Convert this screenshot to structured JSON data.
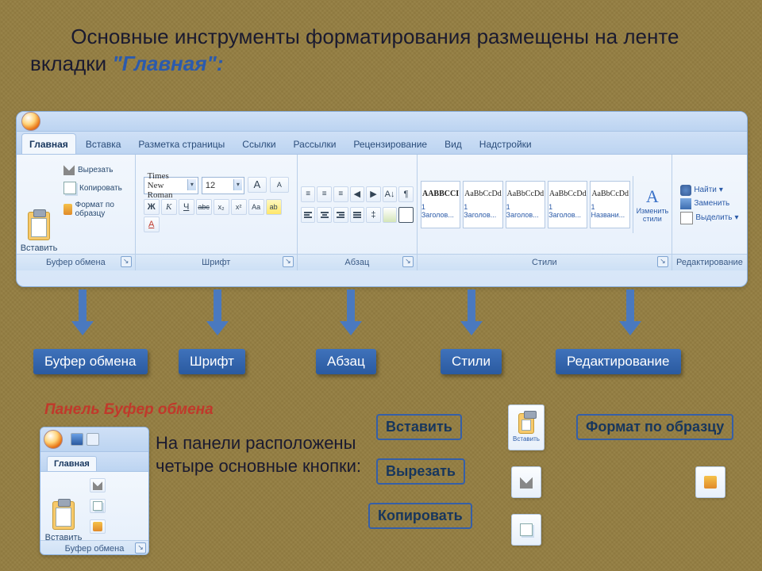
{
  "intro": {
    "text_part1": "Основные инструменты форматирования размещены на ленте вкладки ",
    "quoted": "\"Главная\"",
    "colon": ":"
  },
  "ribbon": {
    "tabs": [
      "Главная",
      "Вставка",
      "Разметка страницы",
      "Ссылки",
      "Рассылки",
      "Рецензирование",
      "Вид",
      "Надстройки"
    ],
    "active_tab_index": 0,
    "clipboard": {
      "label": "Буфер обмена",
      "paste": "Вставить",
      "cut": "Вырезать",
      "copy": "Копировать",
      "format_painter": "Формат по образцу"
    },
    "font": {
      "label": "Шрифт",
      "name": "Times New Roman",
      "size": "12",
      "grow": "A",
      "shrink": "A",
      "bold": "Ж",
      "italic": "К",
      "underline": "Ч",
      "strike": "abc",
      "sub": "x₂",
      "sup": "x²",
      "case": "Aa",
      "highlight": "ab",
      "color": "A"
    },
    "paragraph": {
      "label": "Абзац"
    },
    "styles": {
      "label": "Стили",
      "change": "Изменить стили",
      "items": [
        {
          "preview": "AABBCCI",
          "name": "1 Заголов..."
        },
        {
          "preview": "AaBbCcDd",
          "name": "1 Заголов..."
        },
        {
          "preview": "AaBbCcDd",
          "name": "1 Заголов..."
        },
        {
          "preview": "AaBbCcDd",
          "name": "1 Заголов..."
        },
        {
          "preview": "AaBbCcDd",
          "name": "1 Названи..."
        }
      ]
    },
    "editing": {
      "label": "Редактирование",
      "find": "Найти",
      "replace": "Заменить",
      "select": "Выделить"
    }
  },
  "legend": {
    "clipboard": "Буфер обмена",
    "font": "Шрифт",
    "paragraph": "Абзац",
    "styles": "Стили",
    "editing": "Редактирование"
  },
  "panel": {
    "title": "Панель Буфер обмена",
    "desc": "На панели расположены четыре основные кнопки:",
    "snip_tab": "Главная",
    "snip_paste": "Вставить",
    "snip_label": "Буфер обмена",
    "btns": {
      "paste": "Вставить",
      "cut": "Вырезать",
      "copy": "Копировать",
      "format": "Формат по образцу"
    },
    "mini_paste_label": "Вставить"
  }
}
